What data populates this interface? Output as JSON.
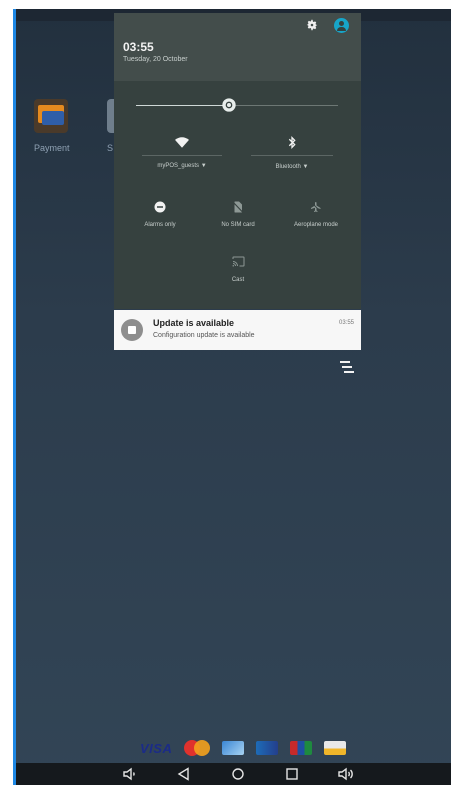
{
  "status": {
    "time": "03:55",
    "date": "Tuesday, 20 October"
  },
  "home": {
    "apps": [
      {
        "label": "Payment"
      },
      {
        "label": "S"
      }
    ]
  },
  "quick_settings": {
    "brightness_level": 0.46,
    "tiles": {
      "wifi": {
        "label": "myPOS_guests",
        "icon": "wifi-icon"
      },
      "bluetooth": {
        "label": "Bluetooth",
        "icon": "bluetooth-icon"
      },
      "alarms": {
        "label": "Alarms only",
        "icon": "do-not-disturb-icon"
      },
      "sim": {
        "label": "No SIM card",
        "icon": "no-sim-icon"
      },
      "aeroplane": {
        "label": "Aeroplane mode",
        "icon": "airplane-icon"
      },
      "cast": {
        "label": "Cast",
        "icon": "cast-icon"
      }
    },
    "caret": "▼"
  },
  "notification": {
    "title": "Update is available",
    "subtitle": "Configuration update is available",
    "time": "03:55"
  },
  "payments": {
    "visa": "VISA"
  },
  "colors": {
    "accent": "#17a5c9",
    "panel": "#36413f",
    "panel_header": "#434d4b",
    "background": "#2c3c4c"
  }
}
